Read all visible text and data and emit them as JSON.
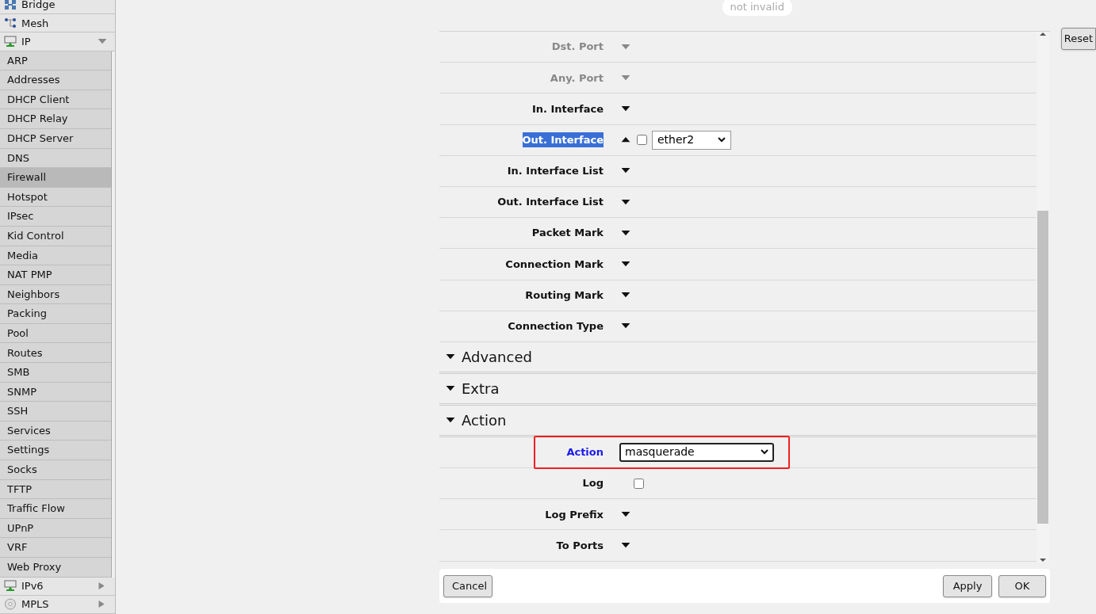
{
  "sidebar": {
    "top_items": [
      {
        "label": "Bridge"
      },
      {
        "label": "Mesh"
      },
      {
        "label": "IP",
        "expanded": true
      }
    ],
    "submenu": [
      {
        "label": "ARP",
        "selected": false
      },
      {
        "label": "Addresses",
        "selected": false
      },
      {
        "label": "DHCP Client",
        "selected": false
      },
      {
        "label": "DHCP Relay",
        "selected": false
      },
      {
        "label": "DHCP Server",
        "selected": false
      },
      {
        "label": "DNS",
        "selected": false
      },
      {
        "label": "Firewall",
        "selected": true
      },
      {
        "label": "Hotspot",
        "selected": false
      },
      {
        "label": "IPsec",
        "selected": false
      },
      {
        "label": "Kid Control",
        "selected": false
      },
      {
        "label": "Media",
        "selected": false
      },
      {
        "label": "NAT PMP",
        "selected": false
      },
      {
        "label": "Neighbors",
        "selected": false
      },
      {
        "label": "Packing",
        "selected": false
      },
      {
        "label": "Pool",
        "selected": false
      },
      {
        "label": "Routes",
        "selected": false
      },
      {
        "label": "SMB",
        "selected": false
      },
      {
        "label": "SNMP",
        "selected": false
      },
      {
        "label": "SSH",
        "selected": false
      },
      {
        "label": "Services",
        "selected": false
      },
      {
        "label": "Settings",
        "selected": false
      },
      {
        "label": "Socks",
        "selected": false
      },
      {
        "label": "TFTP",
        "selected": false
      },
      {
        "label": "Traffic Flow",
        "selected": false
      },
      {
        "label": "UPnP",
        "selected": false
      },
      {
        "label": "VRF",
        "selected": false
      },
      {
        "label": "Web Proxy",
        "selected": false
      }
    ],
    "bottom_items": [
      {
        "label": "IPv6",
        "expanded": false
      },
      {
        "label": "MPLS",
        "expanded": false
      }
    ]
  },
  "form": {
    "badge": "not invalid",
    "rows": [
      {
        "kind": "field",
        "label": "Dst. Port",
        "disabled": true,
        "enabled_filter": false
      },
      {
        "kind": "field",
        "label": "Any. Port",
        "disabled": true,
        "enabled_filter": false
      },
      {
        "kind": "field",
        "label": "In. Interface",
        "disabled": false,
        "enabled_filter": false
      },
      {
        "kind": "field",
        "label": "Out. Interface",
        "disabled": false,
        "enabled_filter": true,
        "selected": true,
        "checked": false,
        "value": "ether2"
      },
      {
        "kind": "field",
        "label": "In. Interface List",
        "disabled": false,
        "enabled_filter": false
      },
      {
        "kind": "field",
        "label": "Out. Interface List",
        "disabled": false,
        "enabled_filter": false
      },
      {
        "kind": "field",
        "label": "Packet Mark",
        "disabled": false,
        "enabled_filter": false
      },
      {
        "kind": "field",
        "label": "Connection Mark",
        "disabled": false,
        "enabled_filter": false
      },
      {
        "kind": "field",
        "label": "Routing Mark",
        "disabled": false,
        "enabled_filter": false
      },
      {
        "kind": "field",
        "label": "Connection Type",
        "disabled": false,
        "enabled_filter": false
      },
      {
        "kind": "section",
        "label": "Advanced",
        "expanded": true
      },
      {
        "kind": "section",
        "label": "Extra",
        "expanded": true
      },
      {
        "kind": "section",
        "label": "Action",
        "expanded": true
      },
      {
        "kind": "select",
        "label": "Action",
        "value": "masquerade",
        "highlighted": true
      },
      {
        "kind": "checkbox",
        "label": "Log",
        "checked": false
      },
      {
        "kind": "field",
        "label": "Log Prefix",
        "disabled": false,
        "enabled_filter": false
      },
      {
        "kind": "field",
        "label": "To Ports",
        "disabled": false,
        "enabled_filter": false
      }
    ],
    "buttons": {
      "cancel": "Cancel",
      "apply": "Apply",
      "ok": "OK"
    }
  },
  "reset": "Reset"
}
